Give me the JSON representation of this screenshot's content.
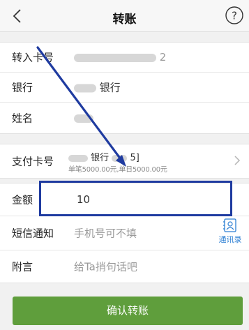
{
  "header": {
    "back_icon": "chevron-left-icon",
    "title": "转账",
    "help_icon": "question-circle-icon",
    "help_glyph": "?"
  },
  "payee": {
    "account": {
      "label": "转入卡号",
      "value_suffix": "2"
    },
    "bank": {
      "label": "银行",
      "value_suffix": "银行"
    },
    "name": {
      "label": "姓名"
    }
  },
  "payment": {
    "label": "支付卡号",
    "card_text": "银行",
    "card_suffix": "5]",
    "limit_text": "单笔5000.00元,单日5000.00元",
    "chevron_icon": "chevron-right-icon"
  },
  "amount": {
    "label": "金额",
    "value": "10"
  },
  "sms": {
    "label": "短信通知",
    "placeholder": "手机号可不填",
    "contacts_icon": "contacts-book-icon",
    "contacts_label": "通讯录"
  },
  "note": {
    "label": "附言",
    "placeholder": "给Ta捎句话吧"
  },
  "confirm": {
    "label": "确认转账"
  },
  "colors": {
    "confirm_green": "#5f9e3c",
    "highlight_blue": "#1f3ba0",
    "link_blue": "#2d7fd3"
  }
}
